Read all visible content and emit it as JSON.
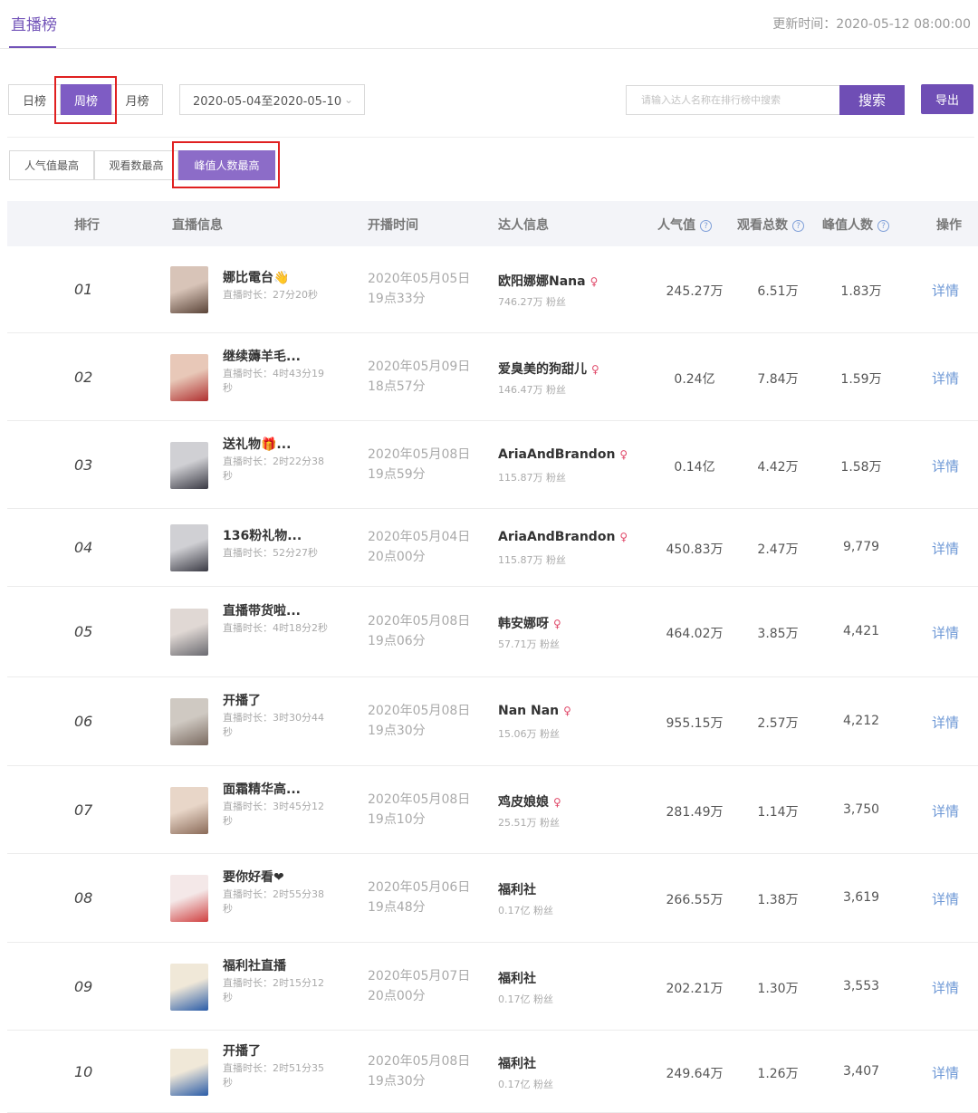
{
  "header": {
    "tab_title": "直播榜",
    "update_time": "更新时间：2020-05-12 08:00:00"
  },
  "period_tabs": [
    "日榜",
    "周榜",
    "月榜"
  ],
  "date_range": "2020-05-04至2020-05-10",
  "search": {
    "placeholder": "请输入达人名称在排行榜中搜索",
    "button": "搜索"
  },
  "export_label": "导出",
  "sort_tabs": [
    "人气值最高",
    "观看数最高",
    "峰值人数最高"
  ],
  "columns": {
    "rank": "排行",
    "live_info": "直播信息",
    "start_time": "开播时间",
    "kol_info": "达人信息",
    "popularity": "人气值",
    "total_views": "观看总数",
    "peak_viewers": "峰值人数",
    "action": "操作"
  },
  "duration_prefix": "直播时长：",
  "fans_suffix": "粉丝",
  "detail_label": "详情",
  "colors": {
    "accent": "#7253b8",
    "highlight_box": "#e02020",
    "link": "#6e98d6"
  },
  "rows": [
    {
      "rank": "01",
      "title": "娜比電台👋",
      "duration": "直播时长：27分20秒",
      "date": "2020年05月05日",
      "time": "19点33分",
      "kol": "欧阳娜娜Nana",
      "female": true,
      "fans": "746.27万 粉丝",
      "popularity": "245.27万",
      "views": "6.51万",
      "peak": "1.83万"
    },
    {
      "rank": "02",
      "title": "继续薅羊毛...",
      "duration": "直播时长：4时43分19秒",
      "date": "2020年05月09日",
      "time": "18点57分",
      "kol": "爱臭美的狗甜儿",
      "female": true,
      "fans": "146.47万 粉丝",
      "popularity": "0.24亿",
      "views": "7.84万",
      "peak": "1.59万"
    },
    {
      "rank": "03",
      "title": "送礼物🎁...",
      "duration": "直播时长：2时22分38秒",
      "date": "2020年05月08日",
      "time": "19点59分",
      "kol": "AriaAndBrandon",
      "female": true,
      "fans": "115.87万 粉丝",
      "popularity": "0.14亿",
      "views": "4.42万",
      "peak": "1.58万"
    },
    {
      "rank": "04",
      "title": "136粉礼物...",
      "duration": "直播时长：52分27秒",
      "date": "2020年05月04日",
      "time": "20点00分",
      "kol": "AriaAndBrandon",
      "female": true,
      "fans": "115.87万 粉丝",
      "popularity": "450.83万",
      "views": "2.47万",
      "peak": "9,779"
    },
    {
      "rank": "05",
      "title": "直播带货啦...",
      "duration": "直播时长：4时18分2秒",
      "date": "2020年05月08日",
      "time": "19点06分",
      "kol": "韩安娜呀",
      "female": true,
      "fans": "57.71万 粉丝",
      "popularity": "464.02万",
      "views": "3.85万",
      "peak": "4,421"
    },
    {
      "rank": "06",
      "title": "开播了",
      "duration": "直播时长：3时30分44秒",
      "date": "2020年05月08日",
      "time": "19点30分",
      "kol": "Nan Nan",
      "female": true,
      "fans": "15.06万 粉丝",
      "popularity": "955.15万",
      "views": "2.57万",
      "peak": "4,212"
    },
    {
      "rank": "07",
      "title": "面霜精华高...",
      "duration": "直播时长：3时45分12秒",
      "date": "2020年05月08日",
      "time": "19点10分",
      "kol": "鸡皮娘娘",
      "female": true,
      "fans": "25.51万 粉丝",
      "popularity": "281.49万",
      "views": "1.14万",
      "peak": "3,750"
    },
    {
      "rank": "08",
      "title": "要你好看❤",
      "duration": "直播时长：2时55分38秒",
      "date": "2020年05月06日",
      "time": "19点48分",
      "kol": "福利社",
      "female": false,
      "fans": "0.17亿 粉丝",
      "popularity": "266.55万",
      "views": "1.38万",
      "peak": "3,619"
    },
    {
      "rank": "09",
      "title": "福利社直播",
      "duration": "直播时长：2时15分12秒",
      "date": "2020年05月07日",
      "time": "20点00分",
      "kol": "福利社",
      "female": false,
      "fans": "0.17亿 粉丝",
      "popularity": "202.21万",
      "views": "1.30万",
      "peak": "3,553"
    },
    {
      "rank": "10",
      "title": "开播了",
      "duration": "直播时长：2时51分35秒",
      "date": "2020年05月08日",
      "time": "19点30分",
      "kol": "福利社",
      "female": false,
      "fans": "0.17亿 粉丝",
      "popularity": "249.64万",
      "views": "1.26万",
      "peak": "3,407"
    }
  ]
}
